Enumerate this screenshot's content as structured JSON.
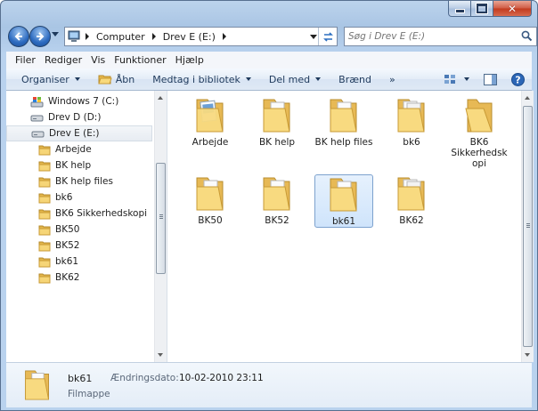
{
  "window": {
    "caption_buttons": [
      "minimize",
      "maximize",
      "close"
    ]
  },
  "address_bar": {
    "crumbs": [
      "Computer",
      "Drev E (E:)"
    ]
  },
  "search": {
    "placeholder": "Søg i Drev E (E:)"
  },
  "menu": [
    "Filer",
    "Rediger",
    "Vis",
    "Funktioner",
    "Hjælp"
  ],
  "commands": {
    "organize": "Organiser",
    "open": "Åbn",
    "library": "Medtag i bibliotek",
    "share": "Del med",
    "burn": "Brænd",
    "more": "»"
  },
  "tree": [
    {
      "label": "Windows 7 (C:)",
      "icon": "windows-drive-icon"
    },
    {
      "label": "Drev D (D:)",
      "icon": "drive-icon"
    },
    {
      "label": "Drev E (E:)",
      "icon": "drive-icon",
      "selected": true
    },
    {
      "label": "Arbejde",
      "icon": "folder-icon"
    },
    {
      "label": "BK help",
      "icon": "folder-icon"
    },
    {
      "label": "BK help files",
      "icon": "folder-icon"
    },
    {
      "label": "bk6",
      "icon": "folder-icon"
    },
    {
      "label": "BK6 Sikkerhedskopi",
      "icon": "folder-icon"
    },
    {
      "label": "BK50",
      "icon": "folder-icon"
    },
    {
      "label": "BK52",
      "icon": "folder-icon"
    },
    {
      "label": "bk61",
      "icon": "folder-icon"
    },
    {
      "label": "BK62",
      "icon": "folder-icon"
    }
  ],
  "files": [
    {
      "name": "Arbejde",
      "icon": "folder-picture-icon"
    },
    {
      "name": "BK help",
      "icon": "folder-icon"
    },
    {
      "name": "BK help files",
      "icon": "folder-icon"
    },
    {
      "name": "bk6",
      "icon": "folder-icon"
    },
    {
      "name": "BK6 Sikkerhedskopi",
      "icon": "folder-open-icon"
    },
    {
      "name": "BK50",
      "icon": "folder-icon"
    },
    {
      "name": "BK52",
      "icon": "folder-icon"
    },
    {
      "name": "bk61",
      "icon": "folder-icon",
      "selected": true
    },
    {
      "name": "BK62",
      "icon": "folder-icon"
    }
  ],
  "details": {
    "name": "bk61",
    "type": "Filmappe",
    "modified_label": "Ændringsdato:",
    "modified_value": "10-02-2010 23:11"
  },
  "colors": {
    "frame": "#a9c5e4",
    "folder": "#f2cf6a",
    "selection": "#cfe4fb",
    "close": "#c23a1e"
  }
}
